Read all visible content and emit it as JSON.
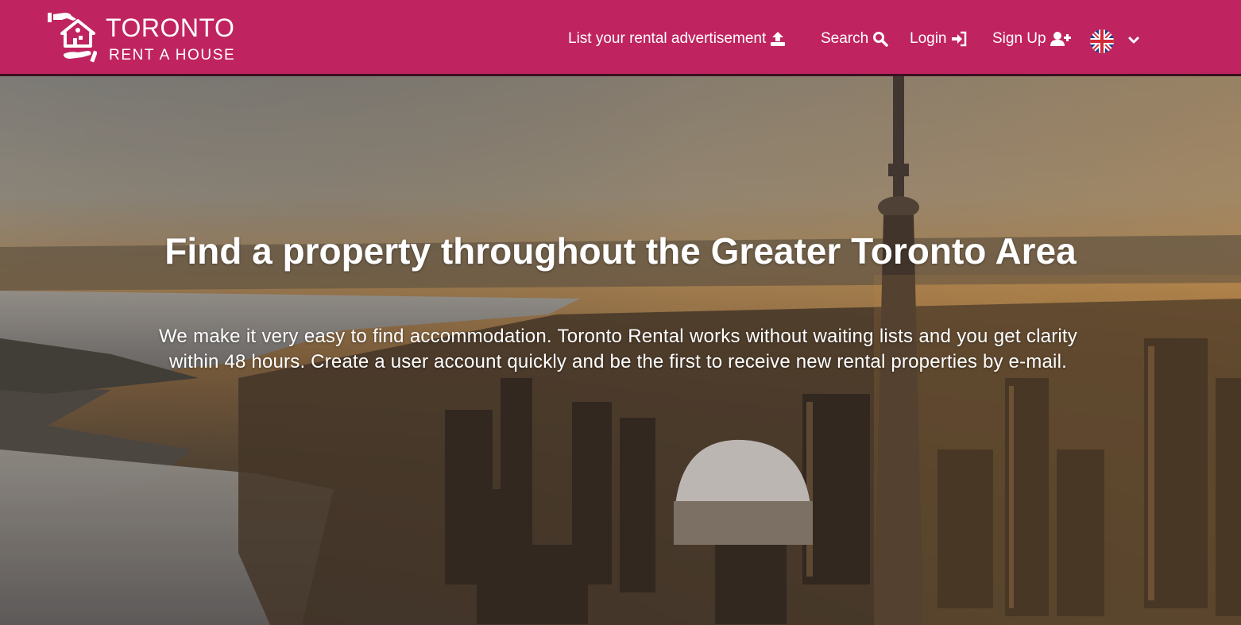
{
  "brand": {
    "title": "TORONTO",
    "subtitle": "RENT A HOUSE",
    "icon": "house-in-hands-icon",
    "color": "#c02460"
  },
  "nav": {
    "list_advert": {
      "label": "List your rental advertisement",
      "icon": "upload-icon"
    },
    "search": {
      "label": "Search",
      "icon": "search-icon"
    },
    "login": {
      "label": "Login",
      "icon": "sign-in-icon"
    },
    "signup": {
      "label": "Sign Up",
      "icon": "user-plus-icon"
    },
    "language": {
      "icon": "uk-flag-icon",
      "dropdown_icon": "chevron-down-icon"
    }
  },
  "hero": {
    "title": "Find a property throughout the Greater Toronto Area",
    "text": "We make it very easy to find accommodation. Toronto Rental works without waiting lists and you get clarity within 48 hours. Create a user account quickly and be the first to receive new rental properties by e-mail.",
    "background": "toronto-skyline-photo"
  }
}
